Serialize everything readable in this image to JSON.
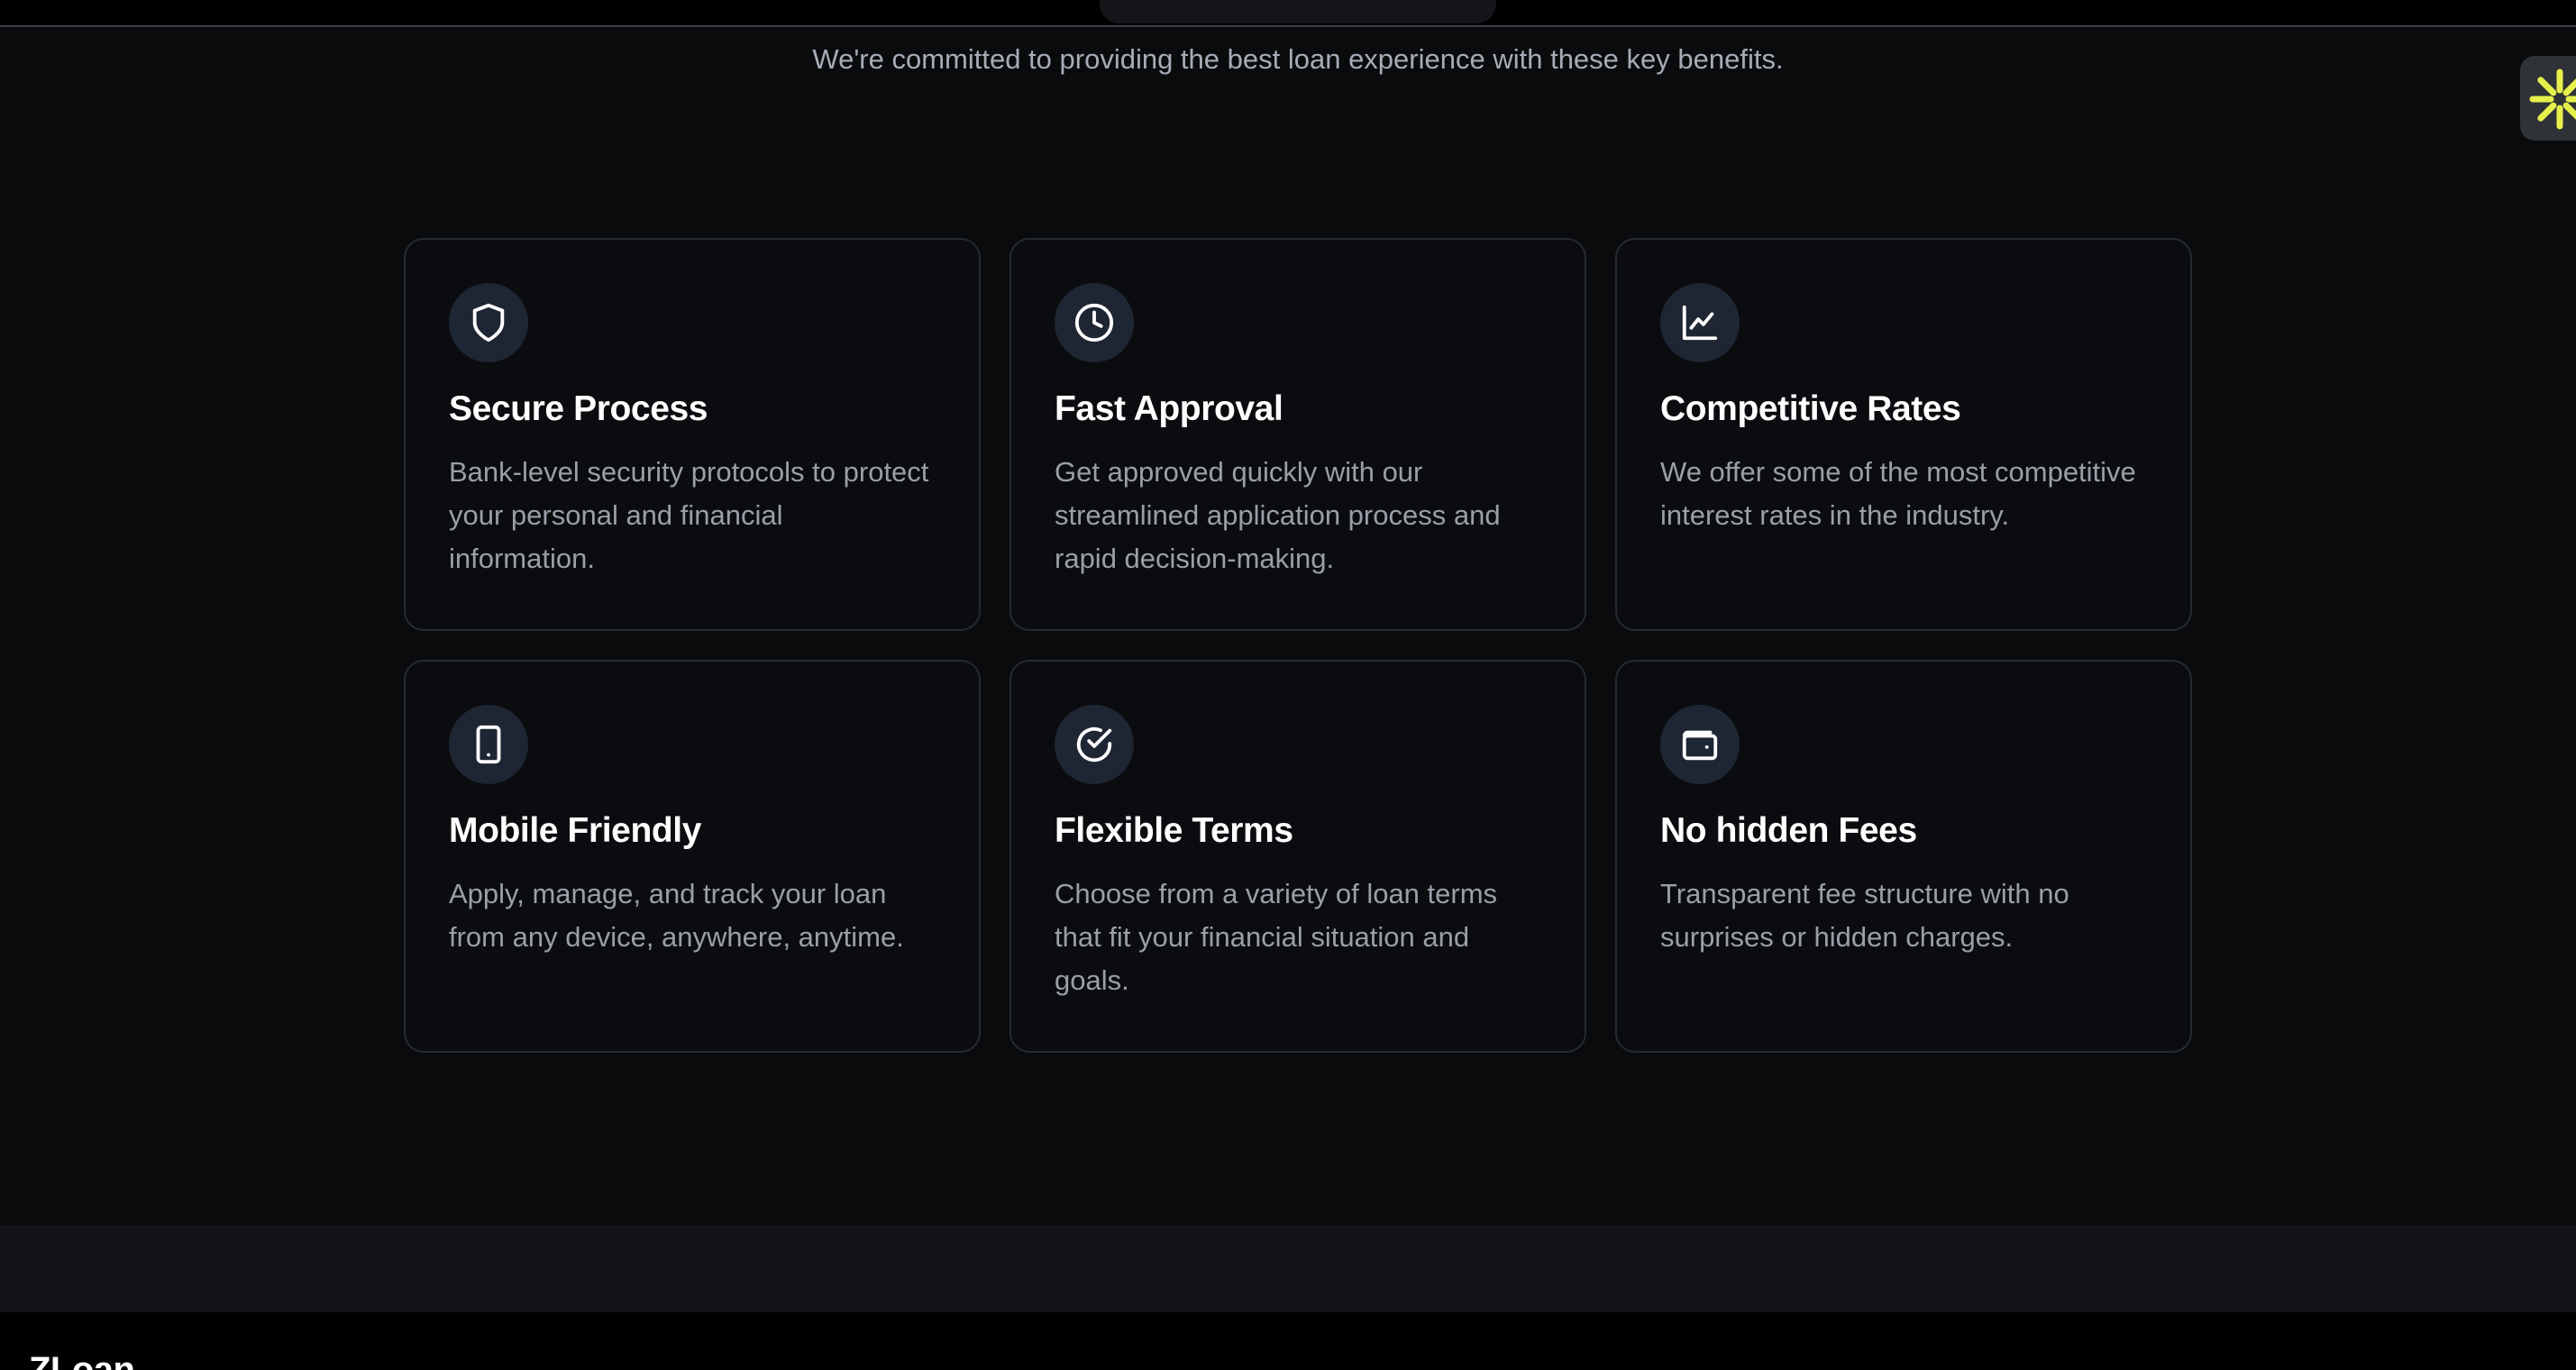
{
  "subtitle": "We're committed to providing the best loan experience with these key benefits.",
  "features": [
    {
      "icon": "shield-icon",
      "title": "Secure Process",
      "description": "Bank-level security protocols to protect your personal and financial information."
    },
    {
      "icon": "clock-icon",
      "title": "Fast Approval",
      "description": "Get approved quickly with our streamlined application process and rapid decision-making."
    },
    {
      "icon": "line-chart-icon",
      "title": "Competitive Rates",
      "description": "We offer some of the most competitive interest rates in the industry."
    },
    {
      "icon": "smartphone-icon",
      "title": "Mobile Friendly",
      "description": "Apply, manage, and track your loan from any device, anywhere, anytime."
    },
    {
      "icon": "check-circle-icon",
      "title": "Flexible Terms",
      "description": "Choose from a variety of loan terms that fit your financial situation and goals."
    },
    {
      "icon": "wallet-icon",
      "title": "No hidden Fees",
      "description": "Transparent fee structure with no surprises or hidden charges."
    }
  ],
  "footer": {
    "brand": "ZLoan"
  },
  "colors": {
    "background": "#0a0b0d",
    "card_border": "#262a33",
    "icon_circle": "#1f2633",
    "title": "#ffffff",
    "description": "#9a9fa8",
    "widget_accent": "#e6f04a"
  },
  "corner_widget": {
    "icon": "sparkle-icon"
  }
}
